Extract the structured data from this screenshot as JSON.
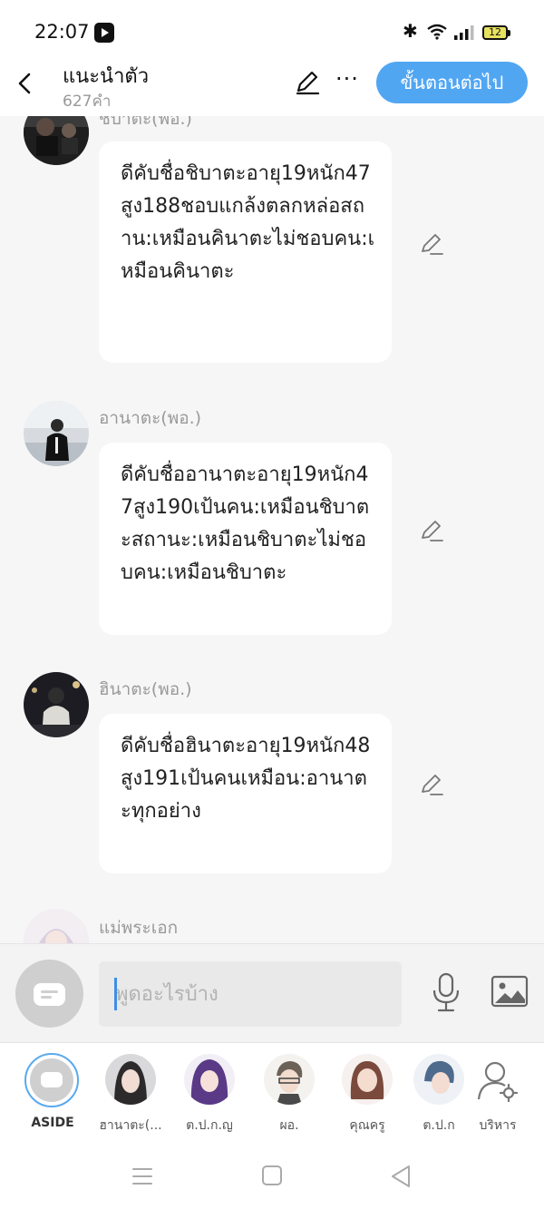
{
  "status_bar": {
    "time": "22:07",
    "battery": "12",
    "icons": [
      "youtube-icon",
      "bluetooth-icon",
      "wifi-icon",
      "signal-icon",
      "battery-icon"
    ]
  },
  "header": {
    "title": "แนะนำตัว",
    "word_count": "627คำ",
    "next_label": "ขั้นตอนต่อไป",
    "accent_color": "#51a6f2"
  },
  "messages": [
    {
      "name": "ชิบาตะ(พอ.)",
      "text": "ดีคับชื่อชิบาตะอายุ19หนัก47สูง188ชอบแกล้งตลกหล่อสถาน:เหมือนคินาตะไม่ชอบคน:เหมือนคินาตะ"
    },
    {
      "name": "อานาตะ(พอ.)",
      "text": "ดีคับชื่ออานาตะอายุ19หนัก47สูง190เป้นคน:เหมือนชิบาตะสถานะ:เหมือนชิบาตะไม่ชอบคน:เหมือนชิบาตะ"
    },
    {
      "name": "ฮินาตะ(พอ.)",
      "text": "ดีคับชื่อฮินาตะอายุ19หนัก48สูง191เป้นคนเหมือน:อานาตะทุกอย่าง"
    },
    {
      "name": "แม่พระเอก",
      "text": ""
    }
  ],
  "input": {
    "placeholder": "พูดอะไรบ้าง"
  },
  "characters": [
    {
      "label": "ASIDE"
    },
    {
      "label": "ฮานาตะ(..."
    },
    {
      "label": "ต.ป.ก.ญ"
    },
    {
      "label": "ผอ."
    },
    {
      "label": "คุณครู"
    },
    {
      "label": "ต.ป.ก"
    },
    {
      "label": "บริหาร"
    }
  ]
}
